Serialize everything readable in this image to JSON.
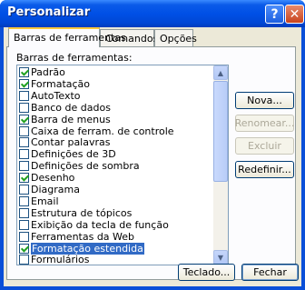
{
  "window": {
    "title": "Personalizar",
    "help_label": "?",
    "close_label": "✕"
  },
  "tabs": [
    {
      "label": "Barras de ferramentas",
      "active": true
    },
    {
      "label": "Comandos",
      "active": false
    },
    {
      "label": "Opções",
      "active": false
    }
  ],
  "toolbar_list": {
    "label": "Barras de ferramentas:",
    "items": [
      {
        "label": "Padrão",
        "checked": true
      },
      {
        "label": "Formatação",
        "checked": true
      },
      {
        "label": "AutoTexto",
        "checked": false
      },
      {
        "label": "Banco de dados",
        "checked": false
      },
      {
        "label": "Barra de menus",
        "checked": true
      },
      {
        "label": "Caixa de ferram. de controle",
        "checked": false
      },
      {
        "label": "Contar palavras",
        "checked": false
      },
      {
        "label": "Definições de 3D",
        "checked": false
      },
      {
        "label": "Definições de sombra",
        "checked": false
      },
      {
        "label": "Desenho",
        "checked": true
      },
      {
        "label": "Diagrama",
        "checked": false
      },
      {
        "label": "Email",
        "checked": false
      },
      {
        "label": "Estrutura de tópicos",
        "checked": false
      },
      {
        "label": "Exibição da tecla de função",
        "checked": false
      },
      {
        "label": "Ferramentas da Web",
        "checked": false
      },
      {
        "label": "Formatação estendida",
        "checked": true,
        "selected": true
      },
      {
        "label": "Formulários",
        "checked": false
      }
    ]
  },
  "side_buttons": {
    "new_label": "Nova...",
    "rename_label": "Renomear...",
    "delete_label": "Excluir",
    "reset_label": "Redefinir..."
  },
  "bottom_buttons": {
    "keyboard_label": "Teclado...",
    "close_label": "Fechar"
  }
}
